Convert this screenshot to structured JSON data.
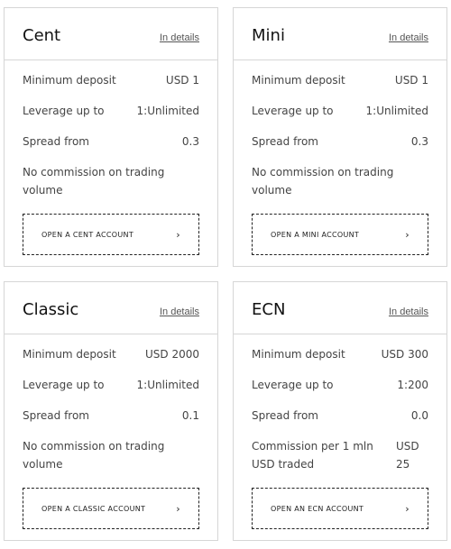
{
  "cards": [
    {
      "title": "Cent",
      "details": "In details",
      "rows": [
        [
          "Minimum deposit",
          "USD 1"
        ],
        [
          "Leverage up to",
          "1:Unlimited"
        ],
        [
          "Spread from",
          "0.3"
        ],
        [
          "No commission on trading volume",
          ""
        ]
      ],
      "button": "OPEN A CENT ACCOUNT"
    },
    {
      "title": "Mini",
      "details": "In details",
      "rows": [
        [
          "Minimum deposit",
          "USD 1"
        ],
        [
          "Leverage up to",
          "1:Unlimited"
        ],
        [
          "Spread from",
          "0.3"
        ],
        [
          "No commission on trading volume",
          ""
        ]
      ],
      "button": "OPEN A MINI ACCOUNT"
    },
    {
      "title": "Classic",
      "details": "In details",
      "rows": [
        [
          "Minimum deposit",
          "USD 2000"
        ],
        [
          "Leverage up to",
          "1:Unlimited"
        ],
        [
          "Spread from",
          "0.1"
        ],
        [
          "No commission on trading volume",
          ""
        ]
      ],
      "button": "OPEN A CLASSIC ACCOUNT"
    },
    {
      "title": "ECN",
      "details": "In details",
      "rows": [
        [
          "Minimum deposit",
          "USD 300"
        ],
        [
          "Leverage up to",
          "1:200"
        ],
        [
          "Spread from",
          "0.0"
        ],
        [
          "Commission per 1 mln USD traded",
          "USD 25"
        ]
      ],
      "button": "OPEN AN ECN ACCOUNT"
    }
  ],
  "chevron_icon": "chevron-right-icon"
}
